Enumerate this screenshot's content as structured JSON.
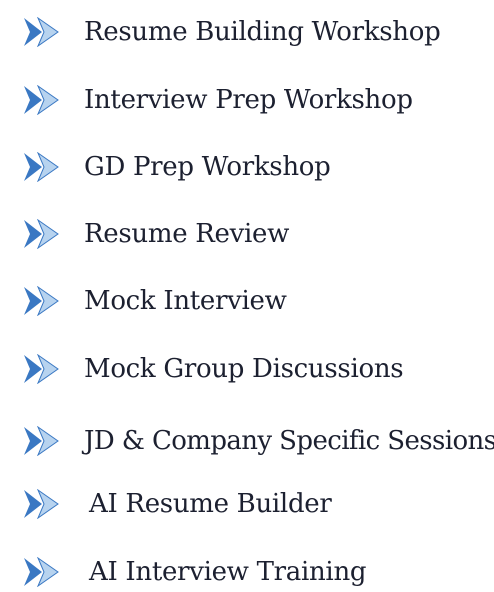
{
  "accent_color": "#3a78c3",
  "light_color": "#b7d3ef",
  "items": [
    {
      "label": "Resume Building Workshop",
      "icon": "double-chevron-right-icon"
    },
    {
      "label": "Interview Prep Workshop",
      "icon": "double-chevron-right-icon"
    },
    {
      "label": "GD Prep Workshop",
      "icon": "double-chevron-right-icon"
    },
    {
      "label": "Resume Review",
      "icon": "double-chevron-right-icon"
    },
    {
      "label": "Mock Interview",
      "icon": "double-chevron-right-icon"
    },
    {
      "label": "Mock Group Discussions",
      "icon": "double-chevron-right-icon"
    },
    {
      "label": "JD & Company Specific Sessions",
      "icon": "double-chevron-right-icon"
    },
    {
      "label": "AI Resume Builder",
      "icon": "double-chevron-right-icon"
    },
    {
      "label": "AI Interview Training",
      "icon": "double-chevron-right-icon"
    }
  ]
}
